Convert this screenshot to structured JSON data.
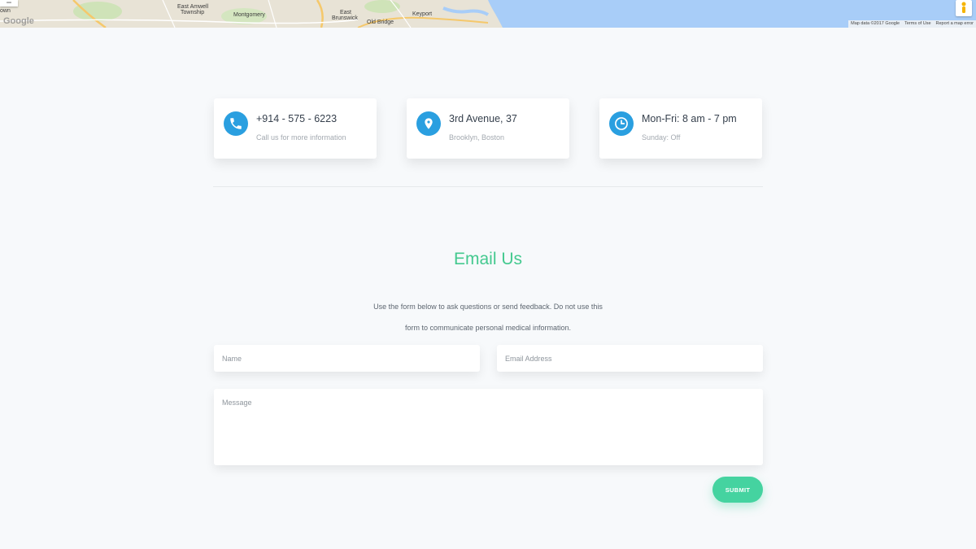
{
  "map": {
    "zoom_out_label": "−",
    "google_label": "Google",
    "labels": [
      {
        "id": "wn",
        "text": "own"
      },
      {
        "id": "ea1",
        "text": "East Amwell"
      },
      {
        "id": "ea2",
        "text": "Township"
      },
      {
        "id": "mont",
        "text": "Montgomery"
      },
      {
        "id": "eb1",
        "text": "East"
      },
      {
        "id": "eb2",
        "text": "Brunswick"
      },
      {
        "id": "ob",
        "text": "Old Bridge"
      },
      {
        "id": "key",
        "text": "Keyport"
      }
    ],
    "footer": {
      "map_data": "Map data ©2017 Google",
      "terms": "Terms of Use",
      "report": "Report a map error"
    },
    "colors": {
      "land": "#e8e3d6",
      "water": "#a8cdf8",
      "road_major": "#f5c86b"
    }
  },
  "cards": [
    {
      "title": "+914 - 575 - 6223",
      "subtitle": "Call us for more information",
      "icon": "phone-icon"
    },
    {
      "title": "3rd Avenue, 37",
      "subtitle": "Brooklyn, Boston",
      "icon": "map-pin-icon"
    },
    {
      "title": "Mon-Fri: 8 am - 7 pm",
      "subtitle": "Sunday: Off",
      "icon": "clock-icon"
    }
  ],
  "email_section": {
    "title": "Email Us",
    "description_line1": "Use the form below to ask questions or send feedback. Do not use this",
    "description_line2": "form to communicate personal medical information."
  },
  "form": {
    "name_placeholder": "Name",
    "email_placeholder": "Email Address",
    "message_placeholder": "Message",
    "submit_label": "SUBMIT"
  },
  "colors": {
    "accent_green": "#44c98f",
    "icon_blue": "#2a9fe0",
    "background": "#f7f9fb"
  }
}
